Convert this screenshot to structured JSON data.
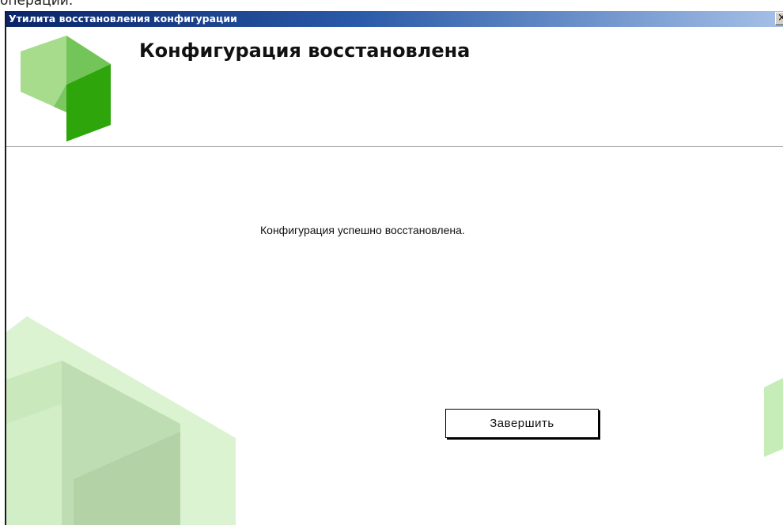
{
  "page": {
    "top_text": "операции."
  },
  "window": {
    "title": "Утилита восстановления конфигурации",
    "close_glyph": "×"
  },
  "header": {
    "title": "Конфигурация восстановлена"
  },
  "content": {
    "message": "Конфигурация успешно восстановлена.",
    "finish_label": "Завершить"
  },
  "colors": {
    "titlebar_start": "#0a246a",
    "titlebar_end": "#a6c1e8",
    "logo_green_light": "#96d67e",
    "logo_green_dark": "#2fa80a",
    "decor_green": "#c6ecb8"
  }
}
